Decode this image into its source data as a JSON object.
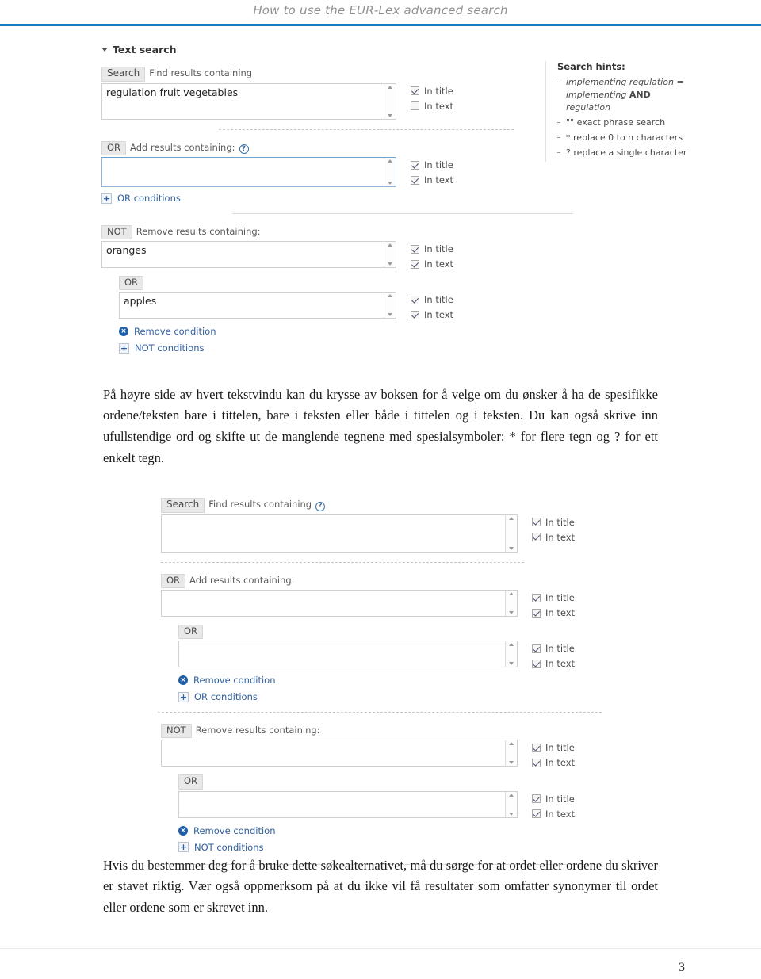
{
  "header": {
    "title": "How to use the EUR-Lex advanced search",
    "rule_color": "#1a7bbd"
  },
  "screenshot_1": {
    "section_title": "Text search",
    "caret_icon": "caret-down-icon",
    "search_block": {
      "badge": "Search",
      "label": "Find results containing",
      "value": "regulation fruit vegetables",
      "checks": [
        {
          "label": "In title",
          "checked": true
        },
        {
          "label": "In text",
          "checked": false
        }
      ]
    },
    "or_block": {
      "badge": "OR",
      "label": "Add results containing:",
      "help_icon": "help-question-icon",
      "help_glyph": "?",
      "value": "",
      "checks": [
        {
          "label": "In title",
          "checked": true
        },
        {
          "label": "In text",
          "checked": true
        }
      ],
      "add_action": {
        "icon": "plus-icon",
        "glyph": "+",
        "label": "OR conditions"
      }
    },
    "not_block": {
      "badge": "NOT",
      "label": "Remove results containing:",
      "value": "oranges",
      "checks": [
        {
          "label": "In title",
          "checked": true
        },
        {
          "label": "In text",
          "checked": true
        }
      ],
      "nested": {
        "badge": "OR",
        "value": "apples",
        "checks": [
          {
            "label": "In title",
            "checked": true
          },
          {
            "label": "In text",
            "checked": true
          }
        ],
        "remove_action": {
          "icon": "remove-circle-icon",
          "glyph": "×",
          "label": "Remove condition"
        }
      },
      "add_action": {
        "icon": "plus-icon",
        "glyph": "+",
        "label": "NOT conditions"
      }
    },
    "hints": {
      "title": "Search hints:",
      "items": [
        {
          "text_pre": "implementing regulation = implementing ",
          "bold": "AND",
          "text_post": " regulation",
          "italic": true
        },
        {
          "text_pre": "\"\" exact phrase search",
          "bold": "",
          "text_post": "",
          "italic": false
        },
        {
          "text_pre": "* replace 0 to n characters",
          "bold": "",
          "text_post": "",
          "italic": false
        },
        {
          "text_pre": "? replace a single character",
          "bold": "",
          "text_post": "",
          "italic": false
        }
      ]
    }
  },
  "paragraph_1": "På høyre side av hvert tekstvindu kan du krysse av boksen for å velge om du ønsker å ha de spesifikke ordene/teksten bare i tittelen, bare i teksten eller både i tittelen og i teksten. Du kan også skrive inn ufullstendige ord og skifte ut de manglende tegnene med spesialsymboler: * for flere tegn og ? for ett enkelt tegn.",
  "screenshot_2": {
    "search_block": {
      "badge": "Search",
      "label": "Find results containing",
      "help_icon": "help-question-icon",
      "help_glyph": "?",
      "value": "",
      "checks": [
        {
          "label": "In title",
          "checked": true
        },
        {
          "label": "In text",
          "checked": true
        }
      ]
    },
    "or_block": {
      "badge": "OR",
      "label": "Add results containing:",
      "value": "",
      "checks": [
        {
          "label": "In title",
          "checked": true
        },
        {
          "label": "In text",
          "checked": true
        }
      ],
      "nested": {
        "badge": "OR",
        "value": "",
        "checks": [
          {
            "label": "In title",
            "checked": true
          },
          {
            "label": "In text",
            "checked": true
          }
        ],
        "remove_action": {
          "icon": "remove-circle-icon",
          "glyph": "×",
          "label": "Remove condition"
        }
      },
      "add_action": {
        "icon": "plus-icon",
        "glyph": "+",
        "label": "OR conditions"
      }
    },
    "not_block": {
      "badge": "NOT",
      "label": "Remove results containing:",
      "value": "",
      "checks": [
        {
          "label": "In title",
          "checked": true
        },
        {
          "label": "In text",
          "checked": true
        }
      ],
      "nested": {
        "badge": "OR",
        "value": "",
        "checks": [
          {
            "label": "In title",
            "checked": true
          },
          {
            "label": "In text",
            "checked": true
          }
        ],
        "remove_action": {
          "icon": "remove-circle-icon",
          "glyph": "×",
          "label": "Remove condition"
        }
      },
      "add_action": {
        "icon": "plus-icon",
        "glyph": "+",
        "label": "NOT conditions"
      }
    }
  },
  "paragraph_2": "Hvis du bestemmer deg for å bruke dette søkealternativet, må du sørge for at ordet eller ordene du skriver er stavet riktig. Vær også oppmerksom på at du ikke vil få resultater som omfatter synonymer til ordet eller ordene som er skrevet inn.",
  "footer": {
    "page_number": "3"
  }
}
